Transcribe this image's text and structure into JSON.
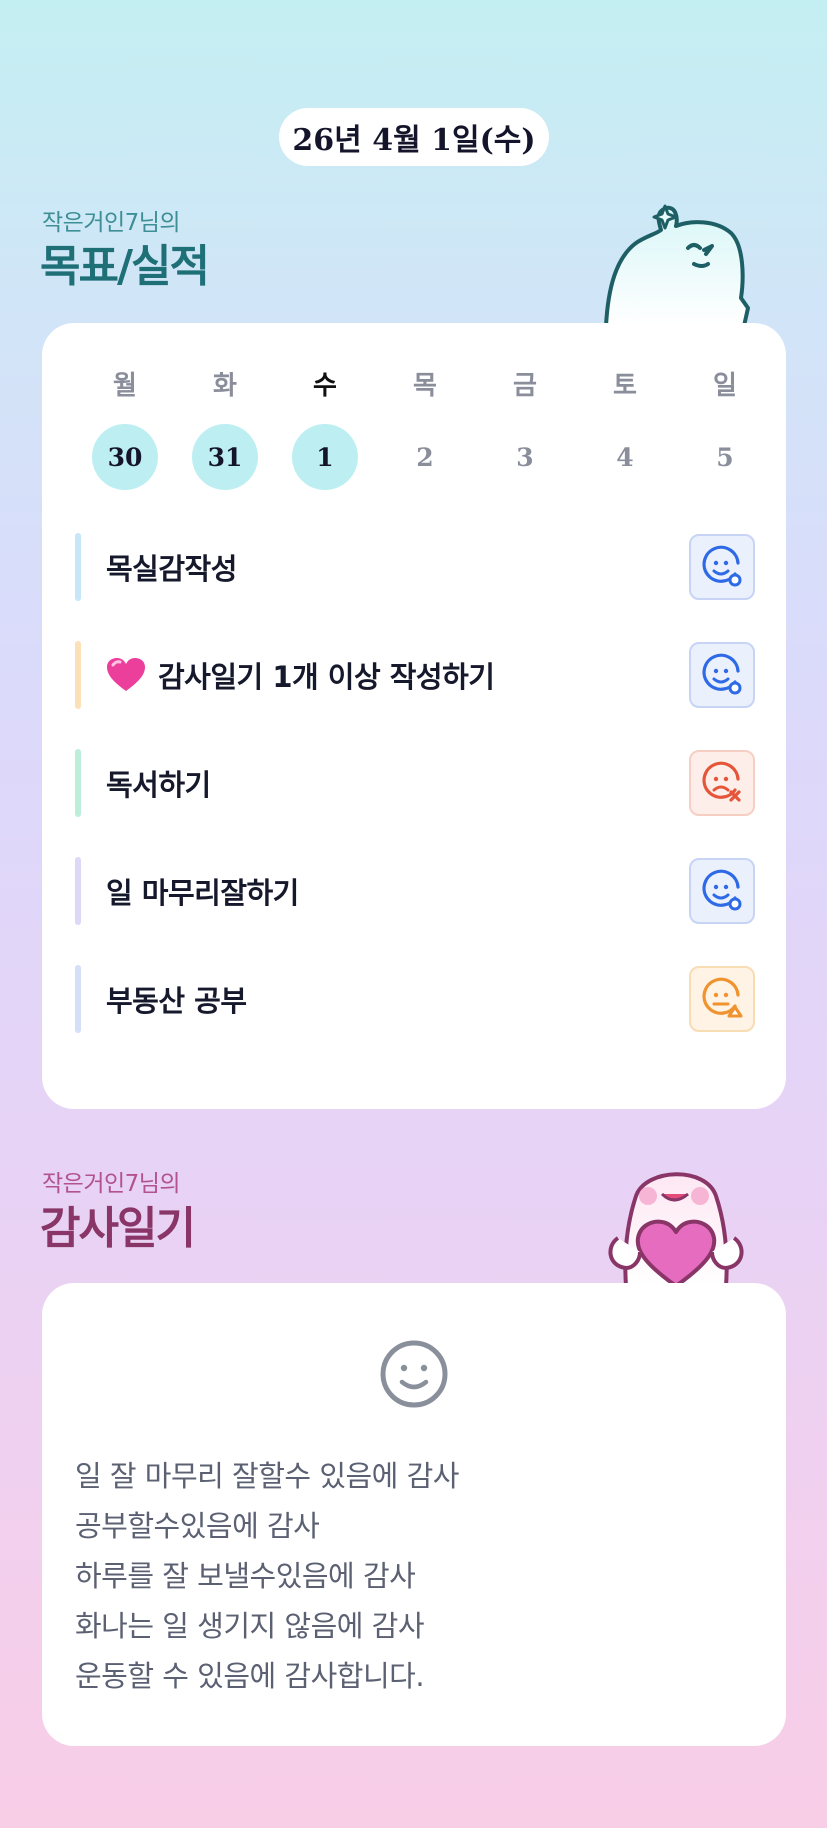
{
  "date_label": "26년 4월 1일(수)",
  "goals_section": {
    "owner": "작은거인7님의",
    "title": "목표/실적"
  },
  "week": {
    "days": [
      "월",
      "화",
      "수",
      "목",
      "금",
      "토",
      "일"
    ],
    "numbers": [
      "30",
      "31",
      "1",
      "2",
      "3",
      "4",
      "5"
    ],
    "today_index": 2,
    "done_indices": [
      0,
      1,
      2
    ]
  },
  "goals": [
    {
      "label": "목실감작성",
      "bar_color": "#c7e6f7",
      "status": "success",
      "icon": "smile-circle-icon"
    },
    {
      "label": "감사일기 1개 이상 작성하기",
      "emoji": "heart-icon",
      "bar_color": "#fbe0b8",
      "status": "success",
      "icon": "smile-circle-icon"
    },
    {
      "label": "독서하기",
      "bar_color": "#bdeed9",
      "status": "fail",
      "icon": "sad-x-icon"
    },
    {
      "label": "일 마무리잘하기",
      "bar_color": "#ded7f7",
      "status": "success",
      "icon": "smile-circle-icon"
    },
    {
      "label": "부동산 공부",
      "bar_color": "#d6dff8",
      "status": "partial",
      "icon": "meh-triangle-icon"
    }
  ],
  "diary_section": {
    "owner": "작은거인7님의",
    "title": "감사일기"
  },
  "diary": {
    "lines": [
      "일 잘 마무리 잘할수 있음에 감사",
      "공부할수있음에 감사",
      "하루를 잘 보낼수있음에 감사",
      "화나는 일 생기지 않음에 감사",
      "운동할 수 있음에 감사합니다."
    ]
  },
  "colors": {
    "success": "#2f6ae6",
    "fail": "#e4553a",
    "partial": "#f0922e",
    "teal": "#1f6f76",
    "plum": "#8a3568"
  }
}
